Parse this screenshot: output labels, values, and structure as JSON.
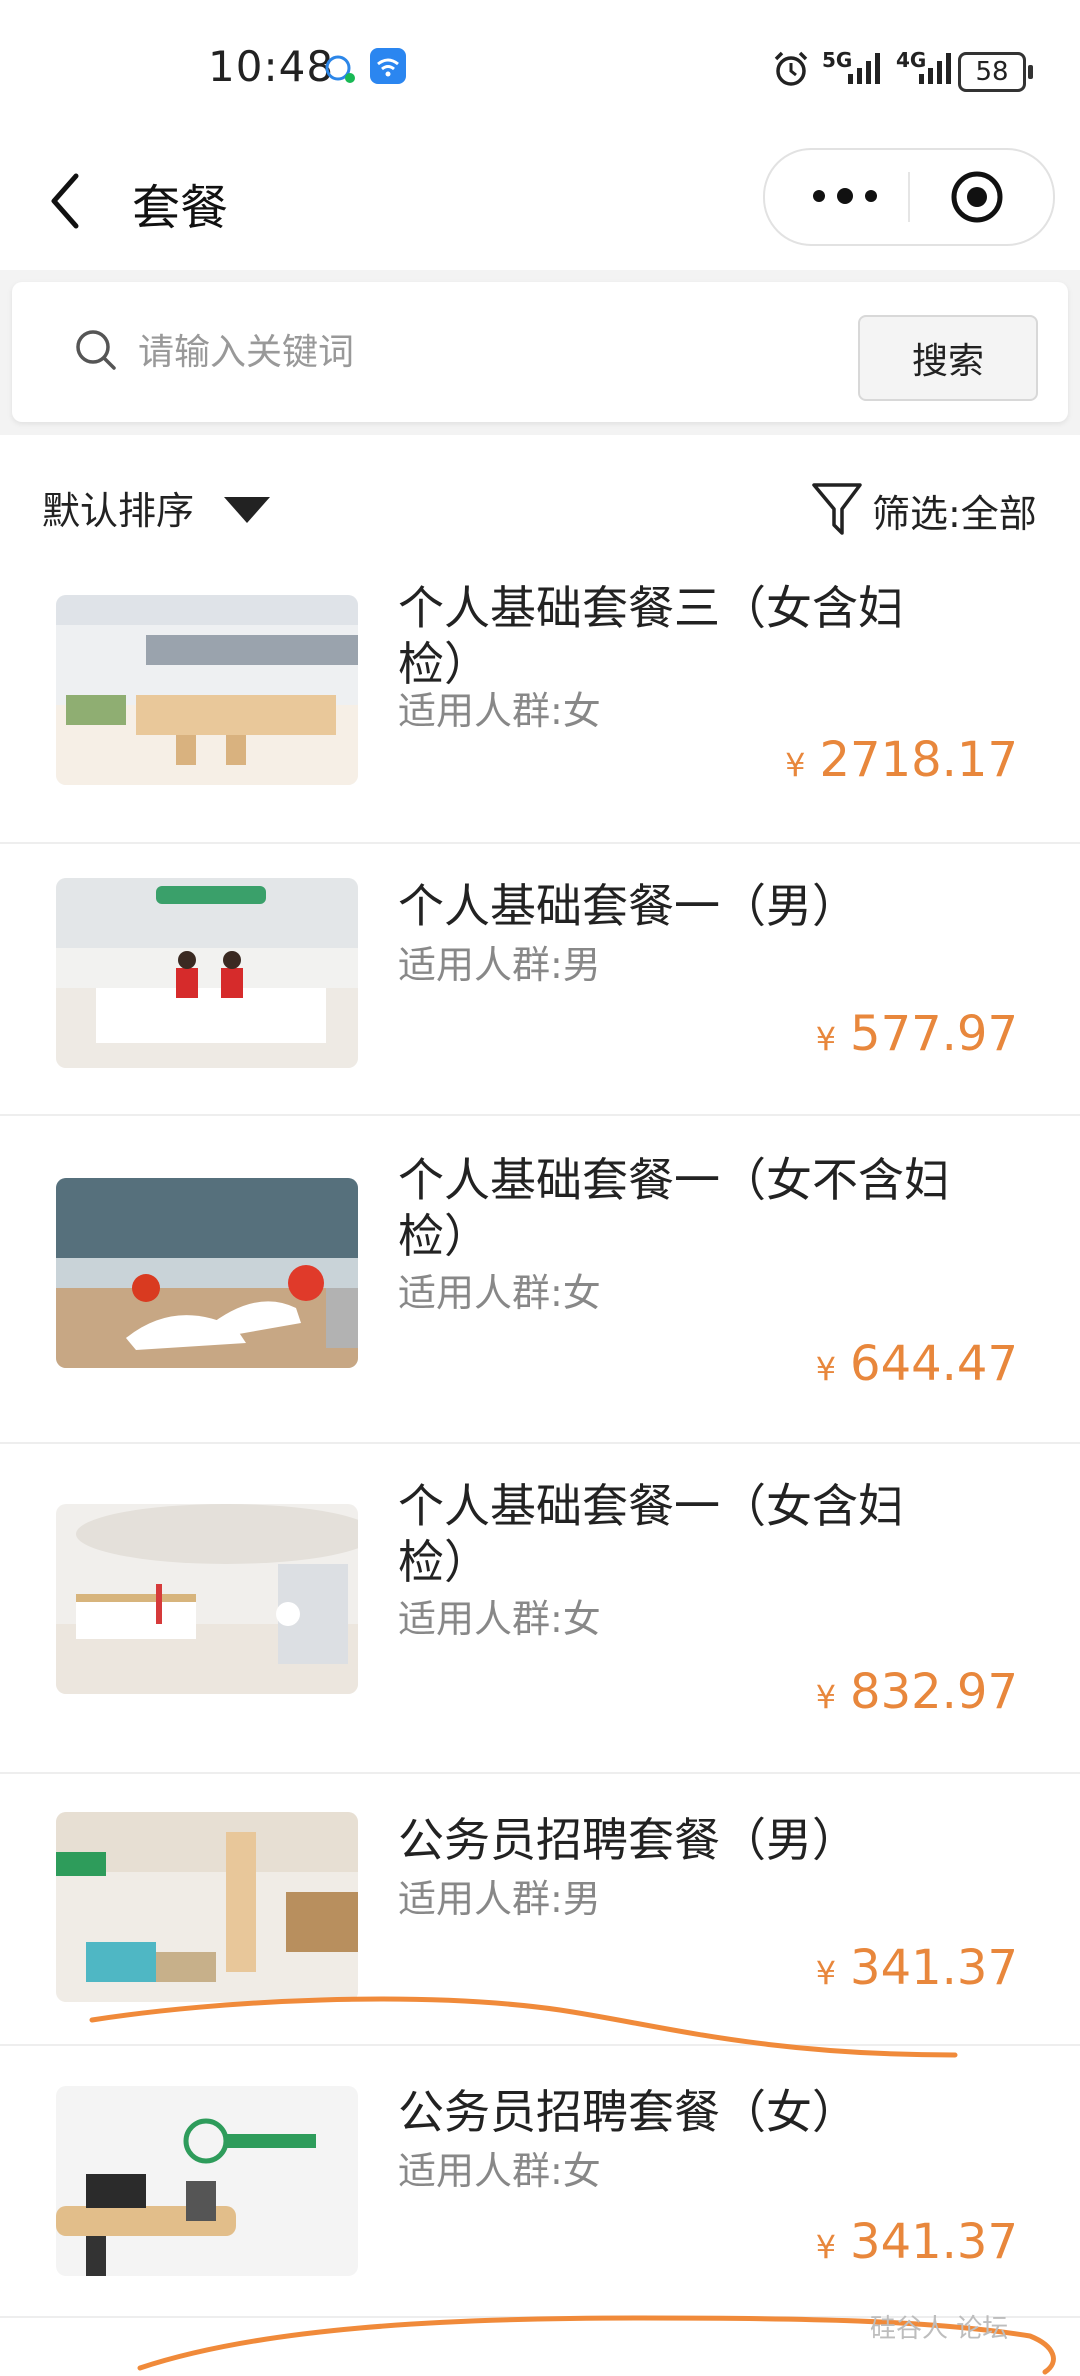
{
  "status_bar": {
    "time": "10:48",
    "battery": "58",
    "net_5g": "5G",
    "net_4g": "4G"
  },
  "nav": {
    "title": "套餐"
  },
  "search": {
    "placeholder": "请输入关键词",
    "button_label": "搜索"
  },
  "sort_bar": {
    "sort_label": "默认排序",
    "filter_label": "筛选:全部"
  },
  "colors": {
    "price": "#e8873c",
    "annotation": "#f08a3a"
  },
  "currency": "¥",
  "items": [
    {
      "title_line1": "个人基础套餐三（女含妇",
      "title_line2": "检）",
      "crowd": "适用人群:女",
      "price": "2718.17"
    },
    {
      "title_line1": "个人基础套餐一（男）",
      "title_line2": "",
      "crowd": "适用人群:男",
      "price": "577.97"
    },
    {
      "title_line1": "个人基础套餐一（女不含妇",
      "title_line2": "检）",
      "crowd": "适用人群:女",
      "price": "644.47"
    },
    {
      "title_line1": "个人基础套餐一（女含妇",
      "title_line2": "检）",
      "crowd": "适用人群:女",
      "price": "832.97"
    },
    {
      "title_line1": "公务员招聘套餐（男）",
      "title_line2": "",
      "crowd": "适用人群:男",
      "price": "341.37"
    },
    {
      "title_line1": "公务员招聘套餐（女）",
      "title_line2": "",
      "crowd": "适用人群:女",
      "price": "341.37"
    }
  ],
  "watermark": "硅谷人 论坛"
}
